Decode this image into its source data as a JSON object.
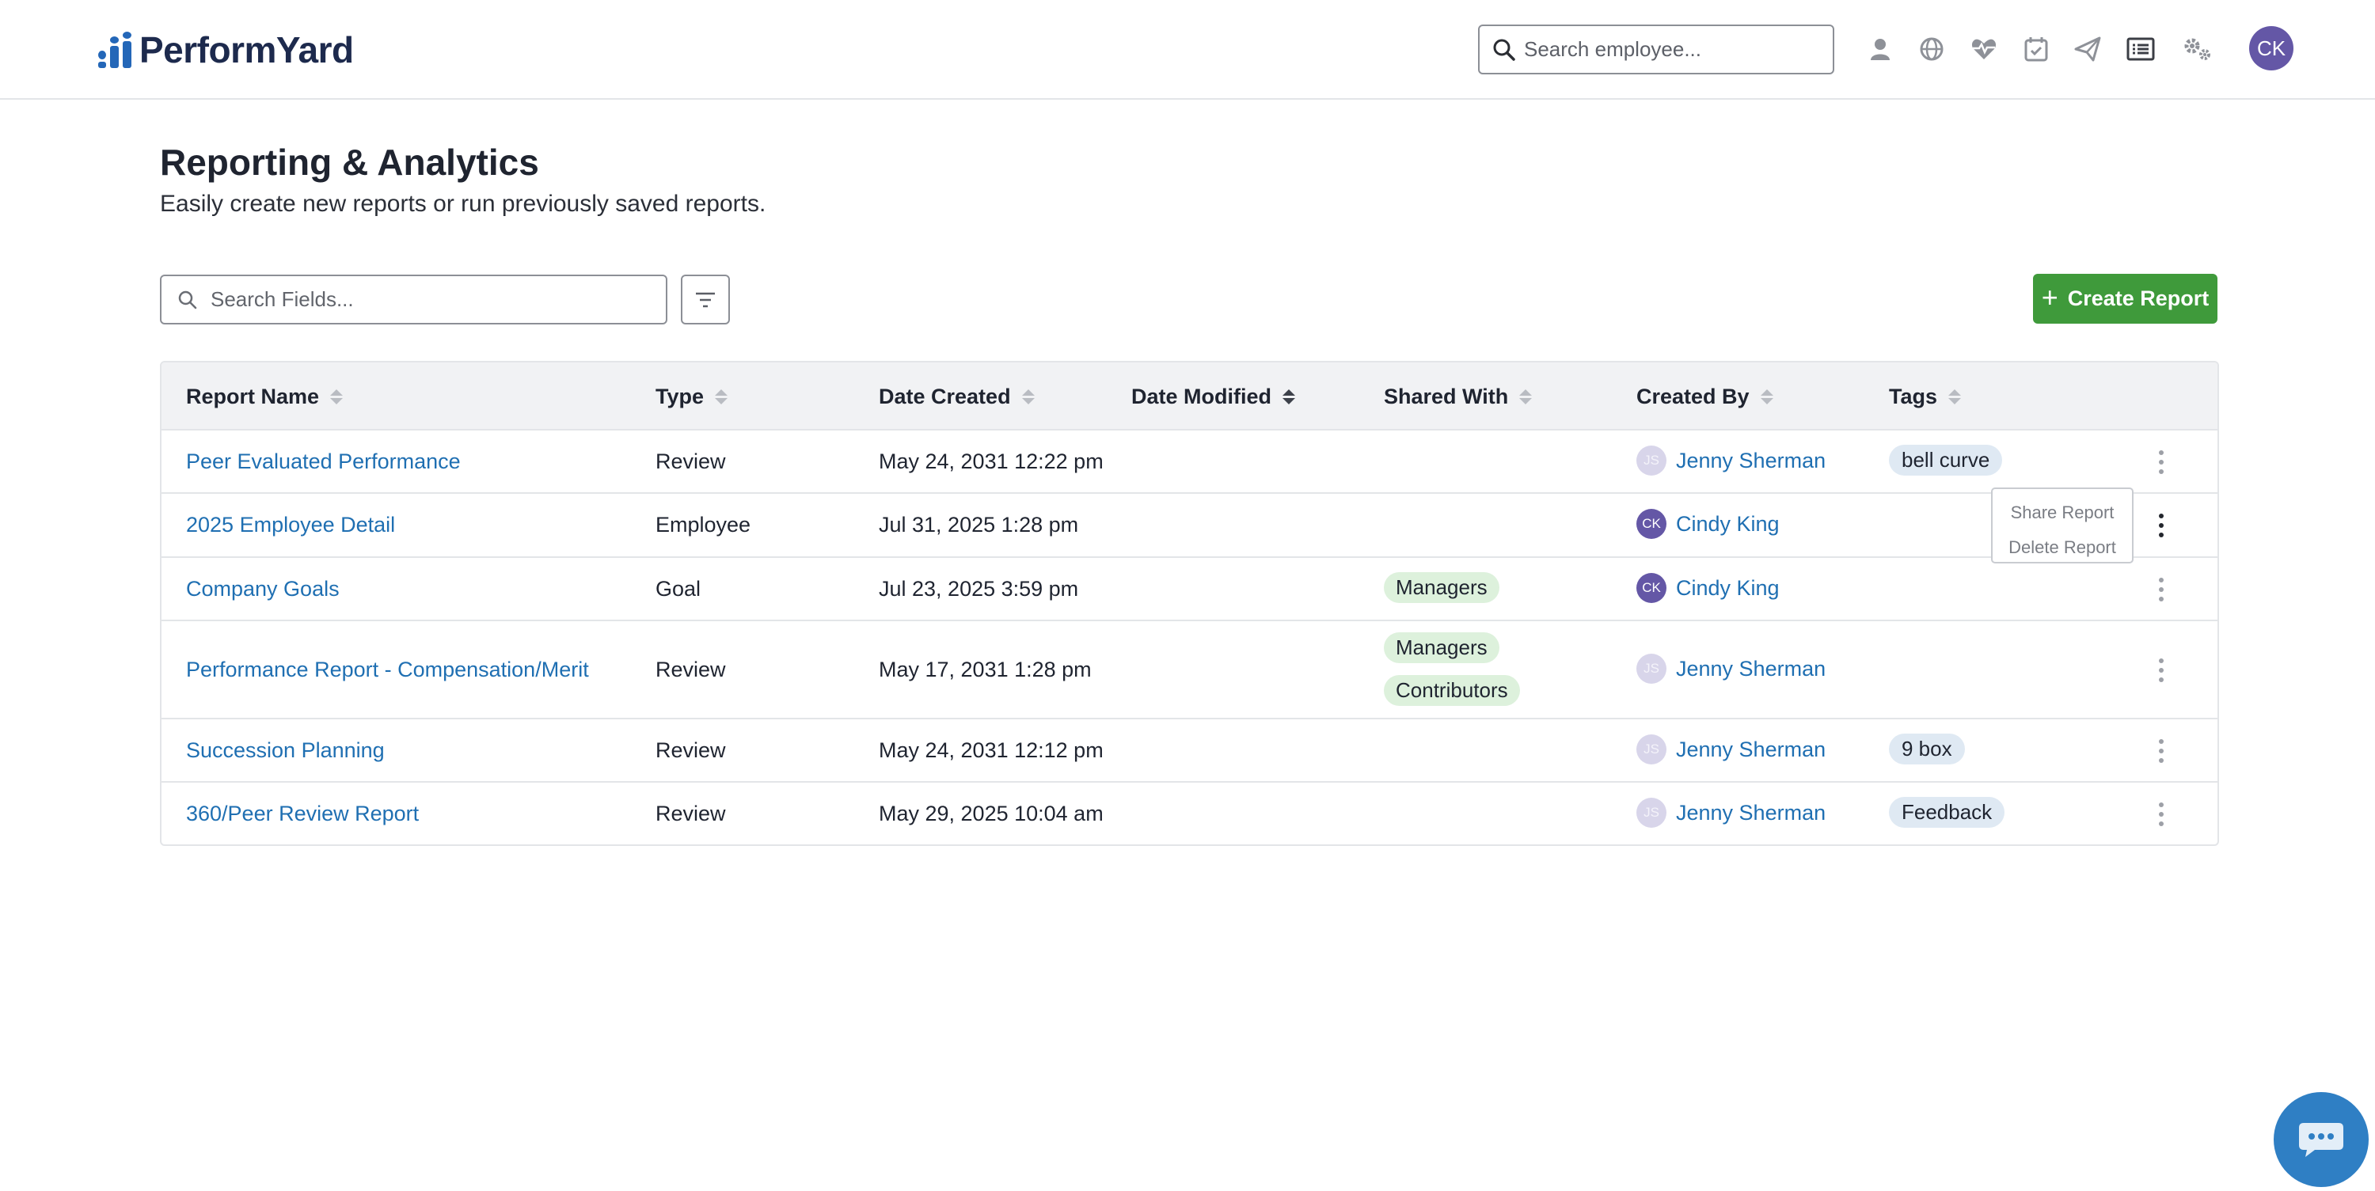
{
  "header": {
    "brand": "PerformYard",
    "search_placeholder": "Search employee...",
    "icons": [
      "person-icon",
      "globe-icon",
      "heartbeat-icon",
      "calendar-check-icon",
      "paper-plane-icon",
      "list-icon",
      "gears-icon"
    ],
    "user_initials": "CK"
  },
  "page": {
    "title": "Reporting & Analytics",
    "subtitle": "Easily create new reports or run previously saved reports."
  },
  "toolbar": {
    "search_placeholder": "Search Fields...",
    "create_label": "Create Report"
  },
  "table": {
    "columns": [
      "Report Name",
      "Type",
      "Date Created",
      "Date Modified",
      "Shared With",
      "Created By",
      "Tags"
    ],
    "sorted_column": "Date Modified",
    "rows": [
      {
        "name": "Peer Evaluated Performance",
        "type": "Review",
        "date_created": "May 24, 2031 12:22 pm",
        "date_modified": "",
        "shared_with": [],
        "created_by": {
          "name": "Jenny Sherman",
          "initials": "JS"
        },
        "tags": [
          "bell curve"
        ]
      },
      {
        "name": "2025 Employee Detail",
        "type": "Employee",
        "date_created": "Jul 31, 2025 1:28 pm",
        "date_modified": "",
        "shared_with": [],
        "created_by": {
          "name": "Cindy King",
          "initials": "CK"
        },
        "tags": []
      },
      {
        "name": "Company Goals",
        "type": "Goal",
        "date_created": "Jul 23, 2025 3:59 pm",
        "date_modified": "",
        "shared_with": [
          "Managers"
        ],
        "created_by": {
          "name": "Cindy King",
          "initials": "CK"
        },
        "tags": []
      },
      {
        "name": "Performance Report - Compensation/Merit",
        "type": "Review",
        "date_created": "May 17, 2031 1:28 pm",
        "date_modified": "",
        "shared_with": [
          "Managers",
          "Contributors"
        ],
        "created_by": {
          "name": "Jenny Sherman",
          "initials": "JS"
        },
        "tags": []
      },
      {
        "name": "Succession Planning",
        "type": "Review",
        "date_created": "May 24, 2031 12:12 pm",
        "date_modified": "",
        "shared_with": [],
        "created_by": {
          "name": "Jenny Sherman",
          "initials": "JS"
        },
        "tags": [
          "9 box"
        ]
      },
      {
        "name": "360/Peer Review Report",
        "type": "Review",
        "date_created": "May 29, 2025 10:04 am",
        "date_modified": "",
        "shared_with": [],
        "created_by": {
          "name": "Jenny Sherman",
          "initials": "JS"
        },
        "tags": [
          "Feedback"
        ]
      }
    ]
  },
  "context_menu": {
    "items": [
      "Share Report",
      "Delete Report"
    ]
  },
  "colors": {
    "brand_navy": "#1d2a4d",
    "brand_blue": "#2467b8",
    "link": "#1f6fb2",
    "create_green": "#3f9a3b",
    "avatar_purple": "#6457a6",
    "chat_blue": "#2f7fc4"
  }
}
